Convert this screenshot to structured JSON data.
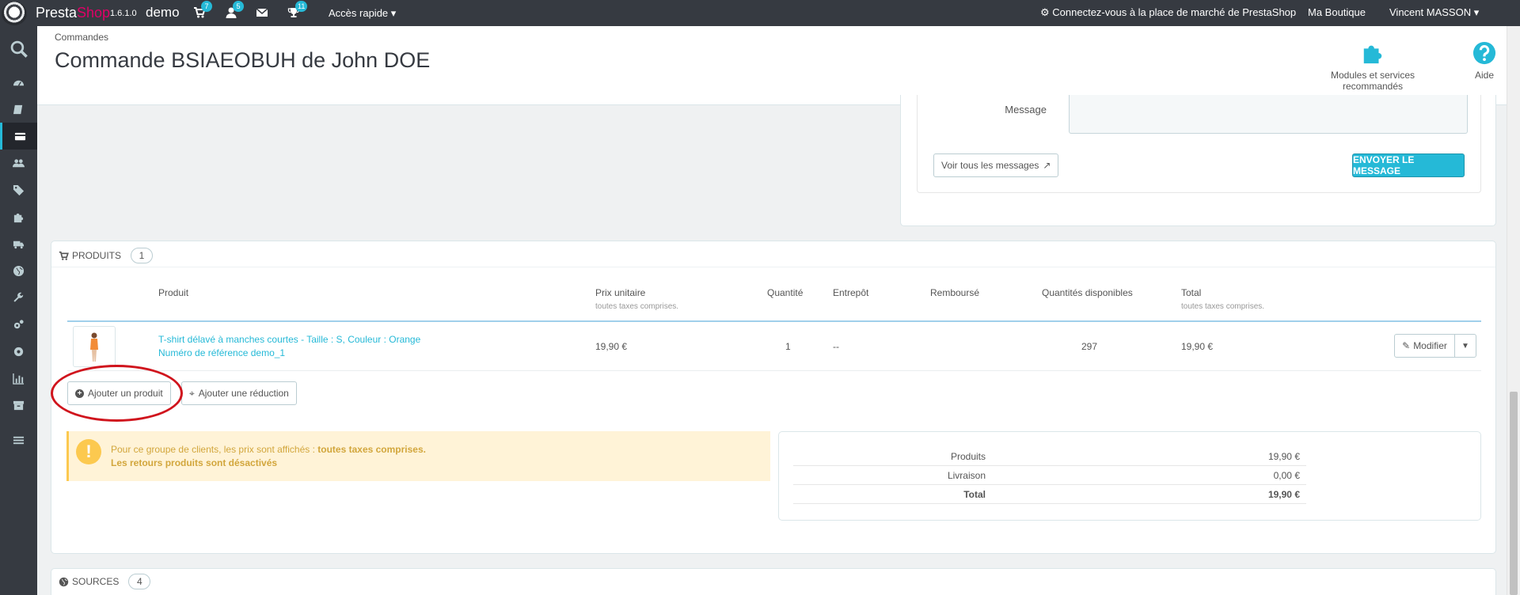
{
  "topbar": {
    "brand_first": "Presta",
    "brand_second": "Shop",
    "version": "1.6.1.0",
    "shop_name": "demo",
    "orders_badge": "7",
    "customers_badge": "5",
    "messages_badge": "",
    "achievements_badge": "11",
    "quick_access": "Accès rapide",
    "marketplace": "Connectez-vous à la place de marché de PrestaShop",
    "my_shop": "Ma Boutique",
    "employee": "Vincent MASSON"
  },
  "header": {
    "breadcrumb": "Commandes",
    "title": "Commande BSIAEOBUH de John DOE",
    "modules_label": "Modules et services recommandés",
    "help_label": "Aide"
  },
  "messages": {
    "message_label": "Message",
    "message_value": "",
    "view_all": "Voir tous les messages",
    "send": "ENVOYER LE MESSAGE"
  },
  "products": {
    "heading": "PRODUITS",
    "count": "1",
    "columns": {
      "product": "Produit",
      "unit_price": "Prix unitaire",
      "unit_price_note": "toutes taxes comprises.",
      "quantity": "Quantité",
      "warehouse": "Entrepôt",
      "refunded": "Remboursé",
      "available": "Quantités disponibles",
      "total": "Total",
      "total_note": "toutes taxes comprises."
    },
    "rows": [
      {
        "name": "T-shirt délavé à manches courtes - Taille : S, Couleur : Orange",
        "reference": "Numéro de référence demo_1",
        "unit_price": "19,90 €",
        "quantity": "1",
        "warehouse": "--",
        "refunded": "",
        "available": "297",
        "total": "19,90 €",
        "edit": "Modifier"
      }
    ],
    "add_product": "Ajouter un produit",
    "add_discount": "Ajouter une réduction"
  },
  "alert": {
    "line1_prefix": "Pour ce groupe de clients, les prix sont affichés : ",
    "line1_bold": "toutes taxes comprises.",
    "line2": "Les retours produits sont désactivés"
  },
  "totals": {
    "products_label": "Produits",
    "products_value": "19,90 €",
    "shipping_label": "Livraison",
    "shipping_value": "0,00 €",
    "total_label": "Total",
    "total_value": "19,90 €"
  },
  "sources": {
    "heading": "SOURCES",
    "count": "4"
  },
  "colors": {
    "accent": "#25b9d7",
    "topbar": "#363a41",
    "warning_bg": "#fff3d7",
    "annotation": "#d0141d"
  }
}
